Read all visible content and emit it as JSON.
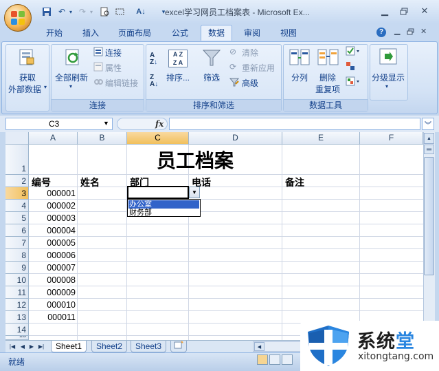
{
  "title_bar": {
    "title": "excel学习网员工档案表 - Microsoft Ex..."
  },
  "ribbon_tabs": [
    "开始",
    "插入",
    "页面布局",
    "公式",
    "数据",
    "审阅",
    "视图"
  ],
  "active_tab": "数据",
  "ribbon": {
    "get_external": "获取\n外部数据",
    "get_external_line1": "获取",
    "get_external_line2": "外部数据",
    "refresh_all": "全部刷新",
    "connections": "连接",
    "properties": "属性",
    "edit_links": "编辑链接",
    "group_connections": "连接",
    "sort": "排序...",
    "filter": "筛选",
    "clear": "清除",
    "reapply": "重新应用",
    "advanced": "高级",
    "group_sort_filter": "排序和筛选",
    "text_to_columns": "分列",
    "remove_dup_line1": "删除",
    "remove_dup_line2": "重复项",
    "group_data_tools": "数据工具",
    "outline": "分级显示"
  },
  "formula_bar": {
    "name_box": "C3",
    "fx": "fx",
    "formula": ""
  },
  "columns": [
    "A",
    "B",
    "C",
    "D",
    "E",
    "F"
  ],
  "selected_column": "C",
  "rows": [
    "1",
    "2",
    "3",
    "4",
    "5",
    "6",
    "7",
    "8",
    "9",
    "10",
    "11",
    "12",
    "13",
    "14",
    "15"
  ],
  "selected_row": "3",
  "sheet": {
    "title": "员工档案",
    "headers": {
      "A": "编号",
      "B": "姓名",
      "C": "部门",
      "D": "电话",
      "E": "备注"
    },
    "ids": [
      "000001",
      "000002",
      "000003",
      "000004",
      "000005",
      "000006",
      "000007",
      "000008",
      "000009",
      "000010",
      "000011"
    ]
  },
  "dropdown": {
    "options": [
      "办公室",
      "财务部"
    ],
    "highlighted": "办公室"
  },
  "sheet_tabs": [
    "Sheet1",
    "Sheet2",
    "Sheet3"
  ],
  "active_sheet": "Sheet1",
  "status": {
    "text": "就绪"
  },
  "watermark": {
    "brand_part1": "系统",
    "brand_part2": "堂",
    "url": "xitongtang.com"
  },
  "colors": {
    "ribbon_blue": "#c4d7ee",
    "selection_orange": "#f1c05c",
    "dropdown_highlight": "#3163c9"
  }
}
